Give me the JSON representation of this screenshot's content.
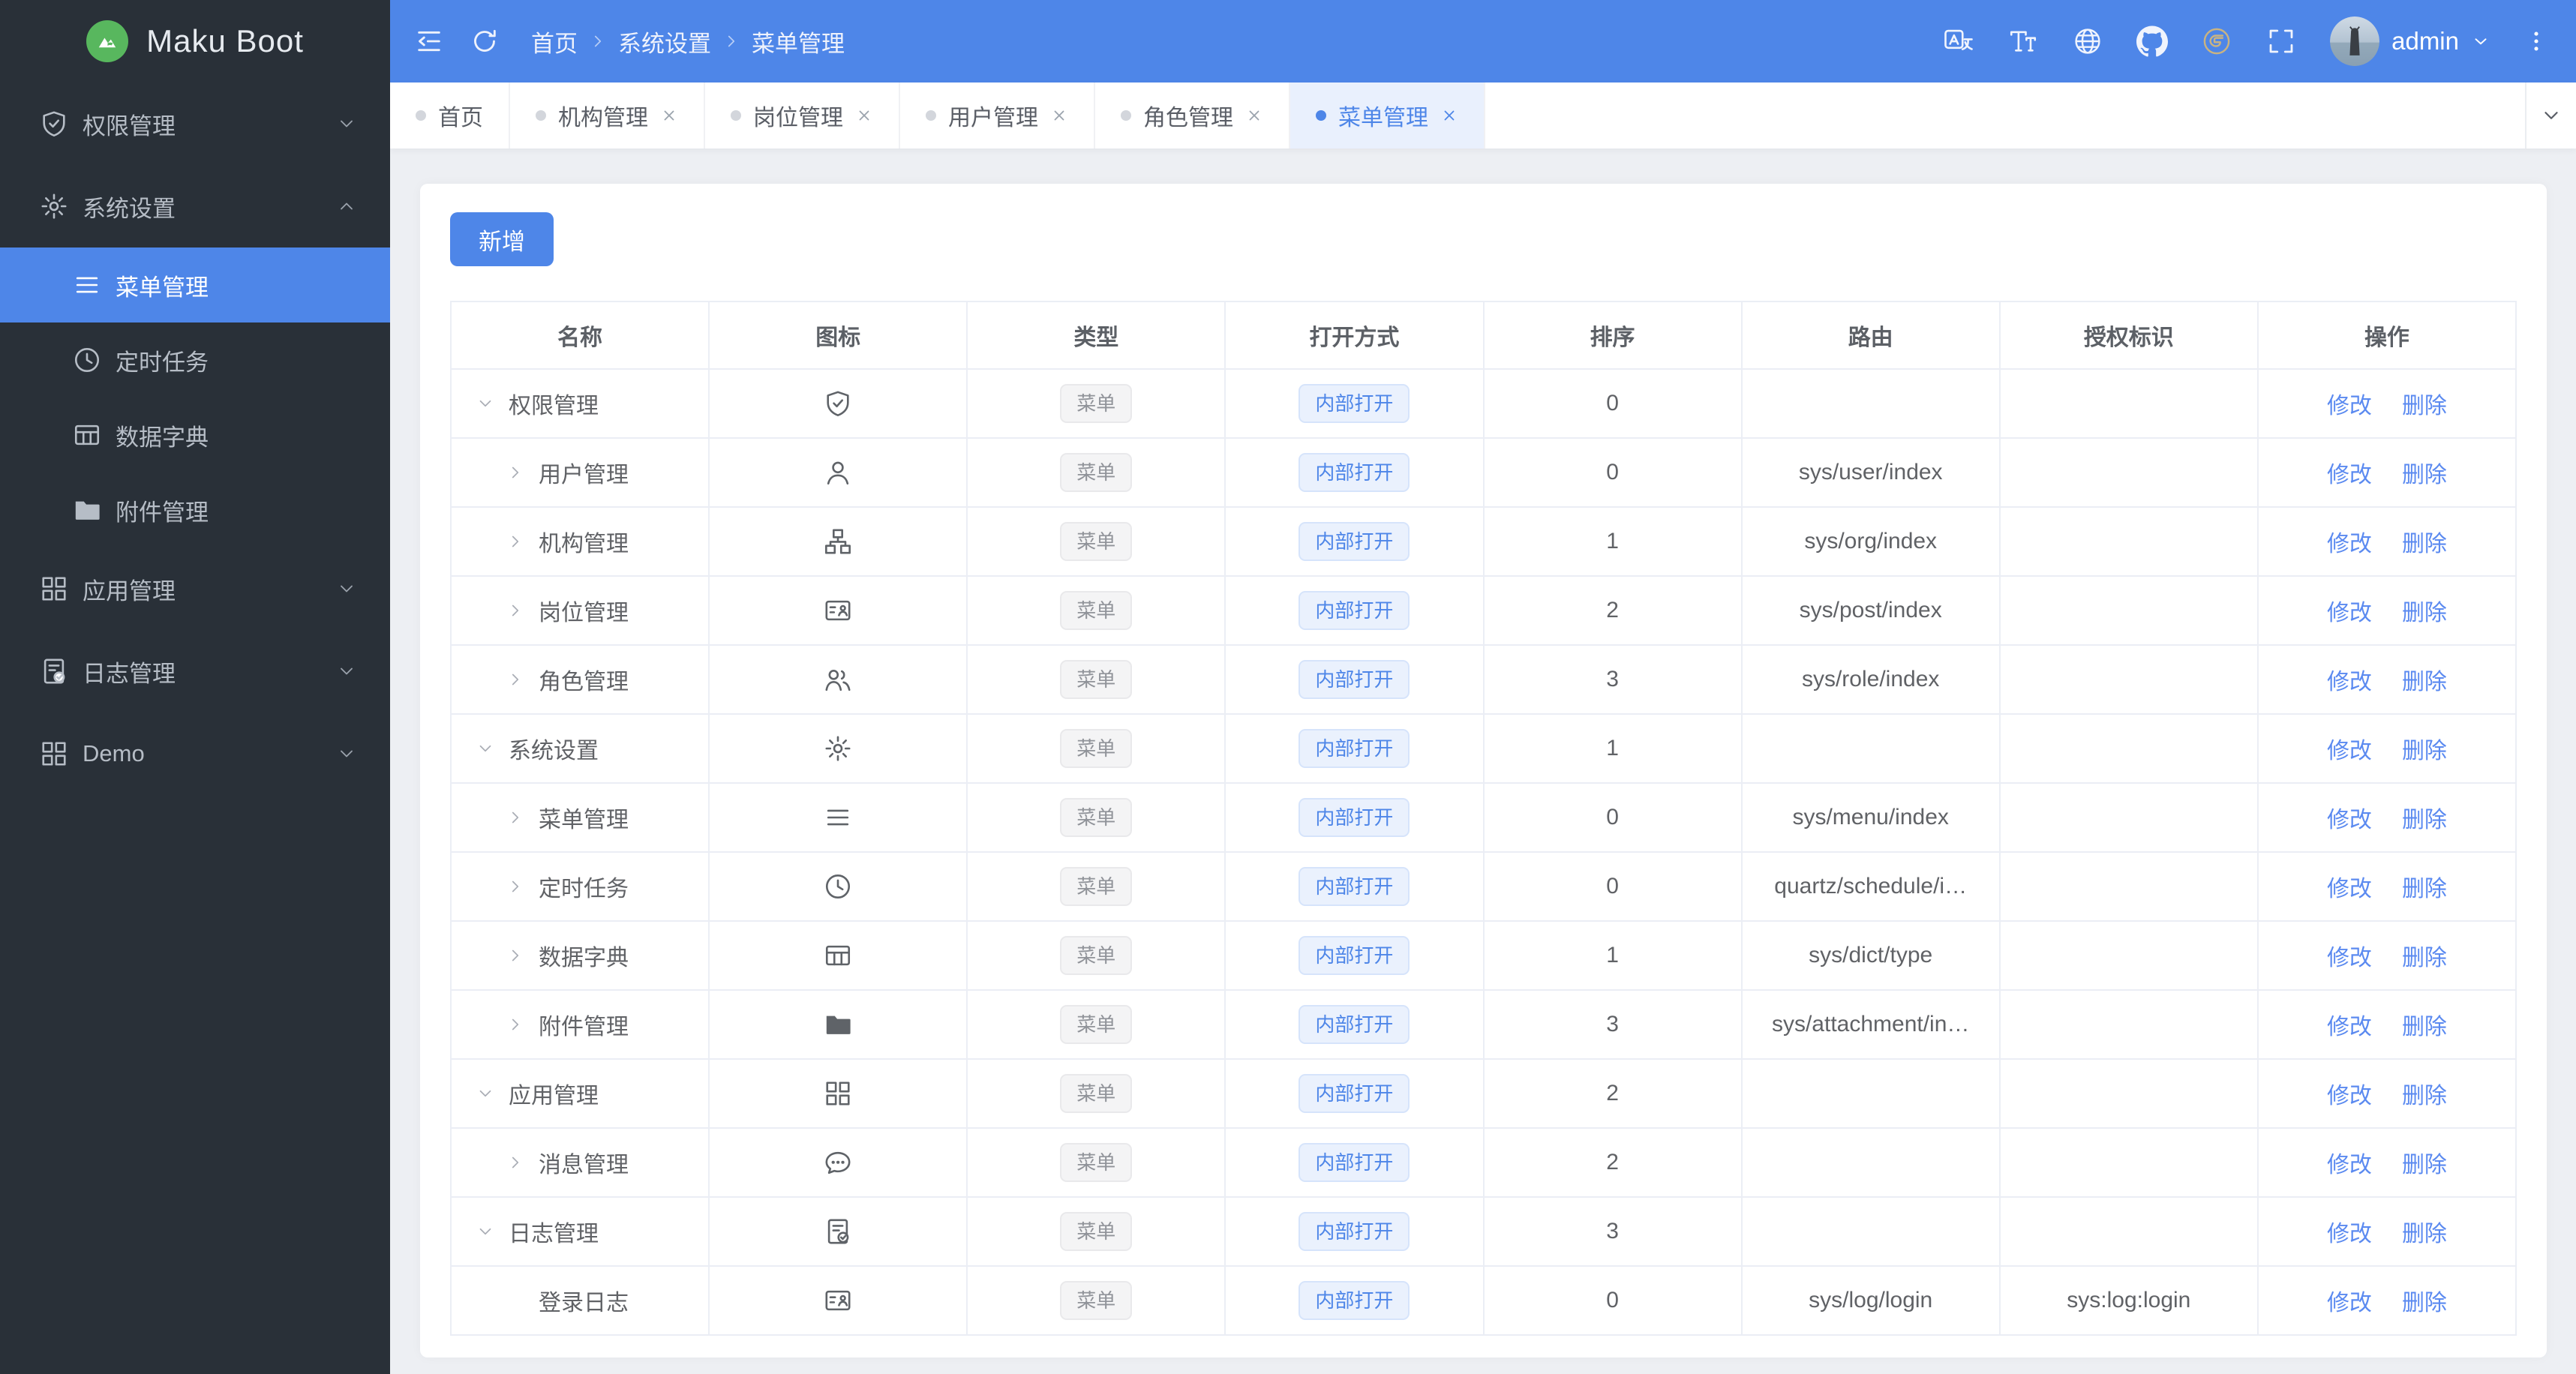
{
  "app": {
    "name": "Maku Boot"
  },
  "colors": {
    "primary": "#4e86e8",
    "sidebar_bg": "#293038",
    "logo_green": "#58b75e",
    "main_bg": "#edeff3",
    "tag_info_text": "#909399",
    "link": "#5b8af0"
  },
  "sidebar": {
    "items": [
      {
        "label": "权限管理",
        "icon": "shield",
        "expanded": false
      },
      {
        "label": "系统设置",
        "icon": "gear",
        "expanded": true,
        "children": [
          {
            "label": "菜单管理",
            "icon": "menu",
            "active": true
          },
          {
            "label": "定时任务",
            "icon": "clock"
          },
          {
            "label": "数据字典",
            "icon": "dict"
          },
          {
            "label": "附件管理",
            "icon": "folder"
          }
        ]
      },
      {
        "label": "应用管理",
        "icon": "grid",
        "expanded": false
      },
      {
        "label": "日志管理",
        "icon": "log",
        "expanded": false
      },
      {
        "label": "Demo",
        "icon": "grid",
        "expanded": false
      }
    ]
  },
  "header": {
    "breadcrumb": [
      "首页",
      "系统设置",
      "菜单管理"
    ],
    "tools": [
      "translate",
      "font-size",
      "globe",
      "github",
      "gitee",
      "fullscreen"
    ],
    "user": {
      "name": "admin"
    }
  },
  "tabs": [
    {
      "label": "首页",
      "closable": false,
      "active": false
    },
    {
      "label": "机构管理",
      "closable": true,
      "active": false
    },
    {
      "label": "岗位管理",
      "closable": true,
      "active": false
    },
    {
      "label": "用户管理",
      "closable": true,
      "active": false
    },
    {
      "label": "角色管理",
      "closable": true,
      "active": false
    },
    {
      "label": "菜单管理",
      "closable": true,
      "active": true
    }
  ],
  "toolbar": {
    "add_label": "新增"
  },
  "table": {
    "columns": [
      "名称",
      "图标",
      "类型",
      "打开方式",
      "排序",
      "路由",
      "授权标识",
      "操作"
    ],
    "type_tag": "菜单",
    "open_tag": "内部打开",
    "actions": [
      "修改",
      "删除"
    ],
    "rows": [
      {
        "name": "权限管理",
        "level": 0,
        "expand": "down",
        "icon": "shield",
        "sort": "0",
        "route": "",
        "auth": ""
      },
      {
        "name": "用户管理",
        "level": 1,
        "expand": "right",
        "icon": "user",
        "sort": "0",
        "route": "sys/user/index",
        "auth": ""
      },
      {
        "name": "机构管理",
        "level": 1,
        "expand": "right",
        "icon": "org",
        "sort": "1",
        "route": "sys/org/index",
        "auth": ""
      },
      {
        "name": "岗位管理",
        "level": 1,
        "expand": "right",
        "icon": "post",
        "sort": "2",
        "route": "sys/post/index",
        "auth": ""
      },
      {
        "name": "角色管理",
        "level": 1,
        "expand": "right",
        "icon": "role",
        "sort": "3",
        "route": "sys/role/index",
        "auth": ""
      },
      {
        "name": "系统设置",
        "level": 0,
        "expand": "down",
        "icon": "gear",
        "sort": "1",
        "route": "",
        "auth": ""
      },
      {
        "name": "菜单管理",
        "level": 1,
        "expand": "right",
        "icon": "menu",
        "sort": "0",
        "route": "sys/menu/index",
        "auth": ""
      },
      {
        "name": "定时任务",
        "level": 1,
        "expand": "right",
        "icon": "clock",
        "sort": "0",
        "route": "quartz/schedule/i…",
        "auth": ""
      },
      {
        "name": "数据字典",
        "level": 1,
        "expand": "right",
        "icon": "dict",
        "sort": "1",
        "route": "sys/dict/type",
        "auth": ""
      },
      {
        "name": "附件管理",
        "level": 1,
        "expand": "right",
        "icon": "folder",
        "sort": "3",
        "route": "sys/attachment/in…",
        "auth": ""
      },
      {
        "name": "应用管理",
        "level": 0,
        "expand": "down",
        "icon": "grid",
        "sort": "2",
        "route": "",
        "auth": ""
      },
      {
        "name": "消息管理",
        "level": 1,
        "expand": "right",
        "icon": "chat",
        "sort": "2",
        "route": "",
        "auth": ""
      },
      {
        "name": "日志管理",
        "level": 0,
        "expand": "down",
        "icon": "log",
        "sort": "3",
        "route": "",
        "auth": ""
      },
      {
        "name": "登录日志",
        "level": 1,
        "expand": "none",
        "icon": "post",
        "sort": "0",
        "route": "sys/log/login",
        "auth": "sys:log:login"
      }
    ]
  }
}
